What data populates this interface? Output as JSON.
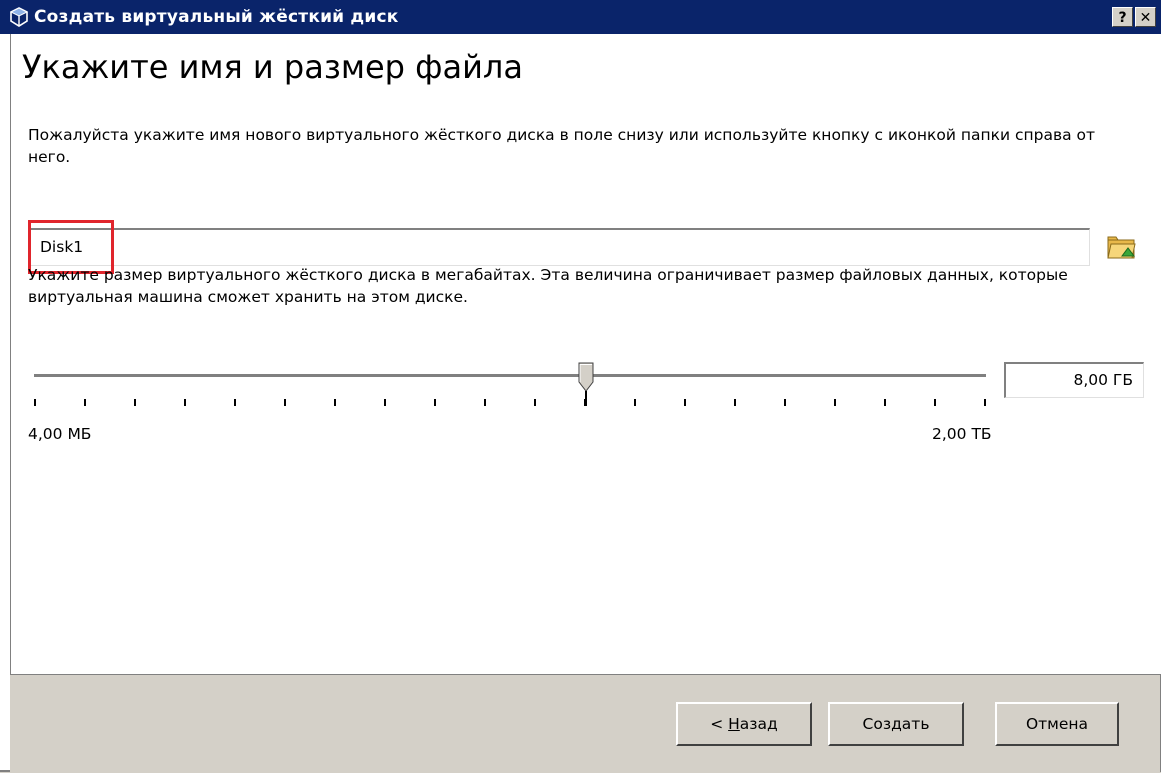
{
  "window": {
    "title": "Создать виртуальный жёсткий диск",
    "help_label": "?",
    "close_label": "✕"
  },
  "page": {
    "heading": "Укажите имя и размер файла",
    "name_instruction": "Пожалуйста укажите имя нового виртуального жёсткого диска в поле снизу или используйте кнопку с иконкой папки справа от него.",
    "name_value": "Disk1",
    "size_instruction": "Укажите размер виртуального жёсткого диска в мегабайтах. Эта величина ограничивает размер файловых данных, которые виртуальная машина сможет хранить на этом диске.",
    "size_value": "8,00 ГБ",
    "slider_min_label": "4,00 МБ",
    "slider_max_label": "2,00 ТБ",
    "slider_position_fraction": 0.58
  },
  "buttons": {
    "back_prefix": "< ",
    "back_underlined": "Н",
    "back_rest": "азад",
    "create": "Создать",
    "cancel": "Отмена"
  },
  "colors": {
    "titlebar": "#0a246a",
    "highlight": "#e0252c",
    "dialog_bg": "#d4d0c8"
  },
  "icons": {
    "app": "virtualbox-icon",
    "folder": "folder-open-icon"
  }
}
